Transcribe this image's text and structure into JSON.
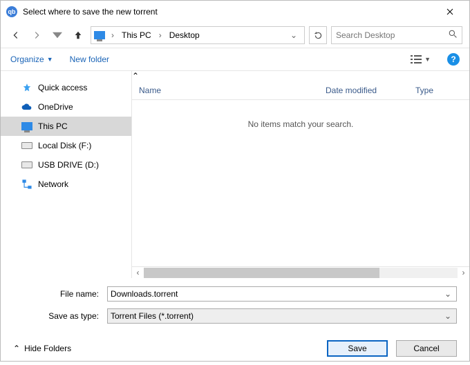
{
  "titlebar": {
    "title": "Select where to save the new torrent"
  },
  "breadcrumb": {
    "root": "This PC",
    "leaf": "Desktop"
  },
  "search": {
    "placeholder": "Search Desktop"
  },
  "toolbar": {
    "organize": "Organize",
    "newfolder": "New folder"
  },
  "tree": {
    "items": [
      {
        "label": "Quick access"
      },
      {
        "label": "OneDrive"
      },
      {
        "label": "This PC"
      },
      {
        "label": "Local Disk (F:)"
      },
      {
        "label": "USB DRIVE (D:)"
      },
      {
        "label": "Network"
      }
    ]
  },
  "columns": {
    "name": "Name",
    "date": "Date modified",
    "type": "Type"
  },
  "empty_message": "No items match your search.",
  "filename": {
    "label": "File name:",
    "value": "Downloads.torrent"
  },
  "filetype": {
    "label": "Save as type:",
    "value": "Torrent Files (*.torrent)"
  },
  "buttons": {
    "hide": "Hide Folders",
    "save": "Save",
    "cancel": "Cancel"
  }
}
